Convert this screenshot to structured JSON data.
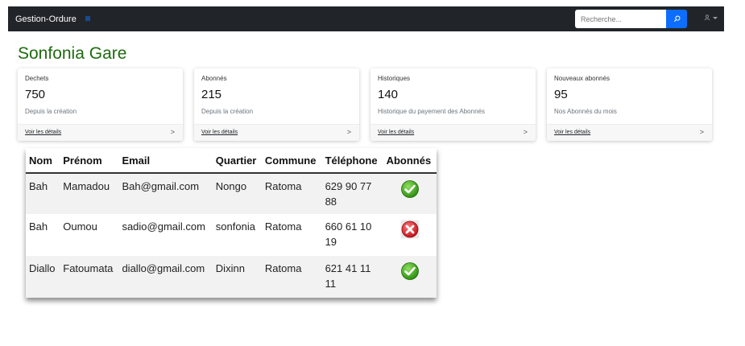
{
  "navbar": {
    "brand": "Gestion-Ordure",
    "toggler_icon": "menu-icon",
    "search_placeholder": "Recherche...",
    "search_icon": "search-icon",
    "user_icon": "user-icon"
  },
  "page": {
    "title": "Sonfonia Gare"
  },
  "cards": [
    {
      "label": "Dechets",
      "value": "750",
      "sub": "Depuis la création",
      "link": "Voir les détails",
      "chevron": ">"
    },
    {
      "label": "Abonnés",
      "value": "215",
      "sub": "Depuis la création",
      "link": "Voir les détails",
      "chevron": ">"
    },
    {
      "label": "Historiques",
      "value": "140",
      "sub": "Historique du payement des Abonnés",
      "link": "Voir les détails",
      "chevron": ">"
    },
    {
      "label": "Nouveaux abonnés",
      "value": "95",
      "sub": "Nos Abonnés du mois",
      "link": "Voir les détails",
      "chevron": ">"
    }
  ],
  "table": {
    "headers": [
      "Nom",
      "Prénom",
      "Email",
      "Quartier",
      "Commune",
      "Téléphone",
      "Abonnés"
    ],
    "rows": [
      {
        "nom": "Bah",
        "prenom": "Mamadou",
        "email": "Bah@gmail.com",
        "quartier": "Nongo",
        "commune": "Ratoma",
        "telephone": "629 90 77 88",
        "abonne": "yes"
      },
      {
        "nom": "Bah",
        "prenom": "Oumou",
        "email": "sadio@gmail.com",
        "quartier": "sonfonia",
        "commune": "Ratoma",
        "telephone": "660 61 10 19",
        "abonne": "no"
      },
      {
        "nom": "Diallo",
        "prenom": "Fatoumata",
        "email": "diallo@gmail.com",
        "quartier": "Dixinn",
        "commune": "Ratoma",
        "telephone": "621 41 11 11",
        "abonne": "yes"
      }
    ]
  },
  "colors": {
    "navbar_bg": "#212529",
    "accent": "#0d6efd",
    "title": "#1e6b0f",
    "check_green": "#3aa51c",
    "cross_red": "#d9232d"
  }
}
